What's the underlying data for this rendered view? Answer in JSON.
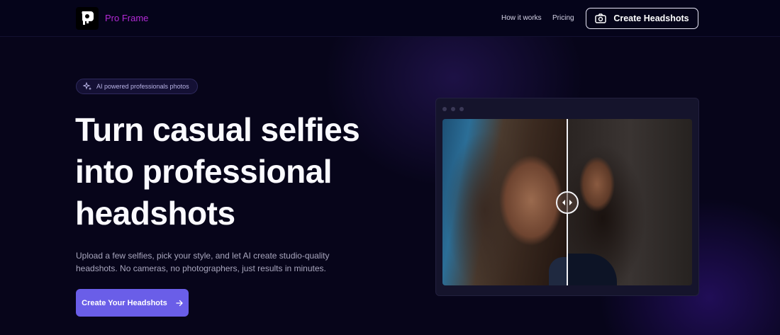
{
  "header": {
    "brand": "Pro Frame",
    "nav": {
      "how_it_works": "How it works",
      "pricing": "Pricing"
    },
    "cta_label": "Create Headshots"
  },
  "badge": {
    "icon": "sparkles-icon",
    "label": "AI powered professionals photos"
  },
  "hero": {
    "title": "Turn casual selfies into professional headshots",
    "subtitle": "Upload a few selfies, pick your style, and let AI create studio-quality headshots. No cameras, no photographers, just results in minutes.",
    "cta_label": "Create Your Headshots"
  },
  "compare": {
    "before_label": "",
    "after_label": "",
    "slider_position": 0.5
  },
  "colors": {
    "background": "#07051a",
    "brand": "#b32ad6",
    "accent": "#6a5ee8"
  }
}
